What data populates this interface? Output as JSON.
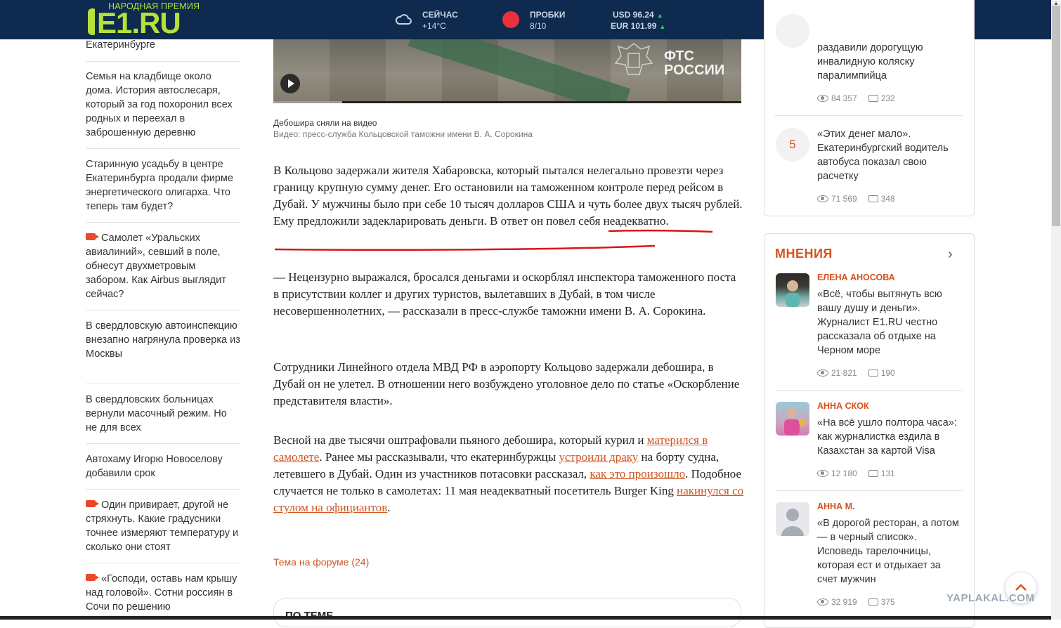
{
  "header": {
    "award": "НАРОДНАЯ ПРЕМИЯ",
    "brand": "E1.RU",
    "weather_label": "СЕЙЧАС",
    "weather_value": "+14°С",
    "traffic_label": "ПРОБКИ",
    "traffic_value": "8/10",
    "usd": "USD 96.24",
    "eur": "EUR 101.99",
    "icons": [
      "search-icon",
      "bell-icon",
      "user-icon",
      "menu-icon"
    ],
    "accent": "#b6e13a",
    "bg": "#0e2a4f"
  },
  "left_news": [
    {
      "text": "Екатеринбурге",
      "video": false
    },
    {
      "text": "Семья на кладбище около дома. История автослесаря, который за год похоронил всех родных и переехал в заброшенную деревню",
      "video": false
    },
    {
      "text": "Старинную усадьбу в центре Екатеринбурга продали фирме энергетического олигарха. Что теперь там будет?",
      "video": false
    },
    {
      "text": "Самолет «Уральских авиалиний», севший в поле, обнесут двухметровым забором. Как Airbus выглядит сейчас?",
      "video": true
    },
    {
      "text": "В свердловскую автоинспекцию внезапно нагрянула проверка из Москвы",
      "video": false
    },
    {
      "text": "В свердловских больницах вернули масочный режим. Но не для всех",
      "video": false
    },
    {
      "text": "Автохаму Игорю Новоселову добавили срок",
      "video": false
    },
    {
      "text": "Один привирает, другой не стряхнуть. Какие градусники точнее измеряют температуру и сколько они стоят",
      "video": true
    },
    {
      "text": "«Господи, оставь нам крышу над головой». Сотни россиян в Сочи по решению",
      "video": true
    }
  ],
  "video": {
    "overlay_line1": "ФТС",
    "overlay_line2": "РОССИИ",
    "caption": "Дебошира сняли на видео",
    "credit": "Видео: пресс-служба Кольцовской таможни имени В. А. Сорокина"
  },
  "article": {
    "p1": "В Кольцово задержали жителя Хабаровска, который пытался нелегально провезти через границу крупную сумму денег. Его остановили на таможенном контроле перед рейсом в Дубай. У мужчины было при себе 10 тысяч долларов США и чуть более двух тысяч рублей. Ему предложили задекларировать деньги. В ответ он повел себя неадекватно.",
    "p2": "— Нецензурно выражался, бросался деньгами и оскорблял инспектора таможенного поста в присутствии коллег и других туристов, вылетавших в Дубай, в том числе несовершеннолетних, — рассказали в пресс-службе таможни имени В. А. Сорокина.",
    "p3": "Сотрудники Линейного отдела МВД РФ в аэропорту Кольцово задержали дебошира, в Дубай он не улетел. В отношении него возбуждено уголовное дело по статье «Оскорбление представителя власти».",
    "p4": {
      "t1": "Весной на две тысячи оштрафовали пьяного дебошира, который курил и ",
      "l1": "матерился в самолете",
      "t2": ". Ранее мы рассказывали, что екатеринбуржцы ",
      "l2": "устроили драку",
      "t3": " на борту судна, летевшего в Дубай. Один из участников потасовки рассказал, ",
      "l3": "как это произошло",
      "t4": ". Подобное случается не только в самолетах: 11 мая неадекватный посетитель Burger King ",
      "l4": "накинулся со стулом на официантов",
      "t5": "."
    },
    "forum_link": "Тема на форуме (24)",
    "related_title": "ПО ТЕМЕ",
    "link_color": "#d1541e"
  },
  "top_news": [
    {
      "text": "раздавили дорогущую инвалидную коляску паралимпийца",
      "views": "84 357",
      "comments": "232"
    },
    {
      "rank": "5",
      "text": "«Этих денег мало». Екатеринбургский водитель автобуса показал свою расчетку",
      "views": "71 569",
      "comments": "348"
    }
  ],
  "opinions": {
    "title": "МНЕНИЯ",
    "items": [
      {
        "author": "ЕЛЕНА АНОСОВА",
        "text": "«Всё, чтобы вытянуть всю вашу душу и деньги». Журналист E1.RU честно рассказала об отдыхе на Черном море",
        "views": "21 821",
        "comments": "190"
      },
      {
        "author": "АННА СКОК",
        "text": "«На всё ушло полтора часа»: как журналистка ездила в Казахстан за картой Visa",
        "views": "12 180",
        "comments": "131"
      },
      {
        "author": "АННА М.",
        "text": "«В дорогой ресторан, а потом — в черный список». Исповедь тарелочницы, которая ест и отдыхает за счет мужчин",
        "views": "32 919",
        "comments": "375"
      }
    ]
  },
  "watermark": "YAPLAKAL.COM"
}
